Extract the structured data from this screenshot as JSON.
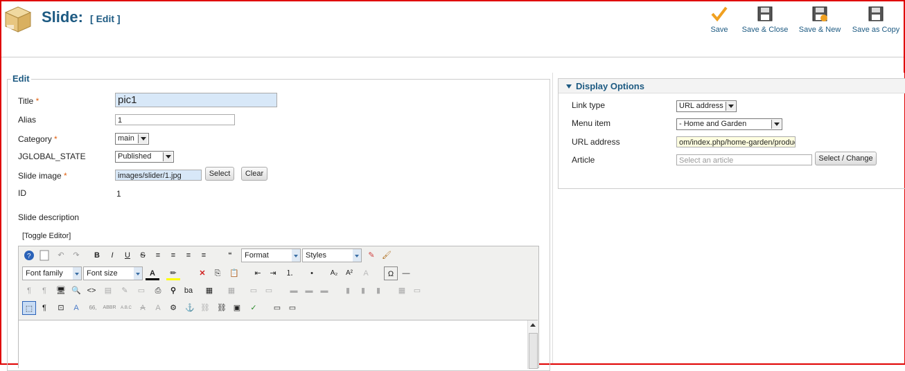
{
  "header": {
    "title": "Slide:",
    "subtitle": "[ Edit ]"
  },
  "toolbar": {
    "save": "Save",
    "save_close": "Save & Close",
    "save_new": "Save & New",
    "save_copy": "Save as Copy"
  },
  "form": {
    "legend": "Edit",
    "title_label": "Title",
    "title_value": "pic1",
    "alias_label": "Alias",
    "alias_value": "1",
    "category_label": "Category",
    "category_value": "main",
    "state_label": "JGLOBAL_STATE",
    "state_value": "Published",
    "image_label": "Slide image",
    "image_value": "images/slider/1.jpg",
    "select_button": "Select",
    "clear_button": "Clear",
    "id_label": "ID",
    "id_value": "1",
    "desc_label": "Slide description",
    "toggle_editor": "[Toggle Editor]",
    "required_mark": "*"
  },
  "editor": {
    "format": "Format",
    "styles": "Styles",
    "font_family": "Font family",
    "font_size": "Font size"
  },
  "display_options": {
    "title": "Display Options",
    "link_type_label": "Link type",
    "link_type_value": "URL address",
    "menu_item_label": "Menu item",
    "menu_item_value": "- Home and Garden",
    "url_label": "URL address",
    "url_value": "om/index.php/home-garden/products",
    "article_label": "Article",
    "article_placeholder": "Select an article",
    "select_change_button": "Select / Change"
  }
}
